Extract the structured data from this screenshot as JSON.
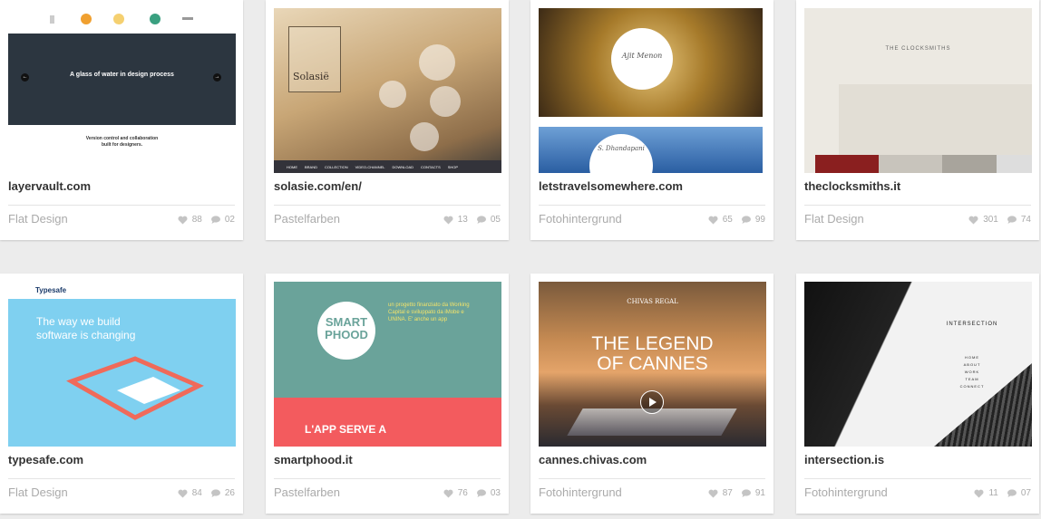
{
  "cards": [
    {
      "title": "layervault.com",
      "category": "Flat Design",
      "likes": "88",
      "comments": "02",
      "thumb": {
        "headline": "A glass of water in design process",
        "sub_line1": "Version control and collaboration",
        "sub_line2": "built for designers."
      }
    },
    {
      "title": "solasie.com/en/",
      "category": "Pastelfarben",
      "likes": "13",
      "comments": "05",
      "thumb": {
        "logo": "Solasië",
        "nav": [
          "HOME",
          "BRAND",
          "COLLECTION",
          "VIDEO-CHANNEL",
          "DOWNLOAD",
          "CONTACTS",
          "SHOP"
        ]
      }
    },
    {
      "title": "letstravelsomewhere.com",
      "category": "Fotohintergrund",
      "likes": "65",
      "comments": "99",
      "thumb": {
        "name1": "Ajit Menon",
        "name2": "S. Dhandapani"
      }
    },
    {
      "title": "theclocksmiths.it",
      "category": "Flat Design",
      "likes": "301",
      "comments": "74",
      "thumb": {
        "brand": "THE CLOCKSMITHS"
      }
    },
    {
      "title": "typesafe.com",
      "category": "Flat Design",
      "likes": "84",
      "comments": "26",
      "thumb": {
        "logo": "Typesafe",
        "headline1": "The way we build",
        "headline2": "software is changing"
      }
    },
    {
      "title": "smartphood.it",
      "category": "Pastelfarben",
      "likes": "76",
      "comments": "03",
      "thumb": {
        "logo1": "SMART",
        "logo2": "PHOOD",
        "tagline": "un progetto finanziato da Working Capital e sviluppato da iMobe e UNINA. E' anche un app",
        "banner": "L'APP SERVE A"
      }
    },
    {
      "title": "cannes.chivas.com",
      "category": "Fotohintergrund",
      "likes": "87",
      "comments": "91",
      "thumb": {
        "brand": "CHIVAS REGAL",
        "headline1": "THE LEGEND",
        "headline2": "OF CANNES"
      }
    },
    {
      "title": "intersection.is",
      "category": "Fotohintergrund",
      "likes": "11",
      "comments": "07",
      "thumb": {
        "brand": "INTERSECTION",
        "menu": [
          "HOME",
          "ABOUT",
          "WORK",
          "TEAM",
          "CONNECT"
        ]
      }
    }
  ],
  "colors": {
    "background": "#ececec",
    "card": "#ffffff",
    "meta": "#aaaaaa"
  },
  "icons": {
    "like": "heart-icon",
    "comment": "comment-bubble-icon"
  }
}
